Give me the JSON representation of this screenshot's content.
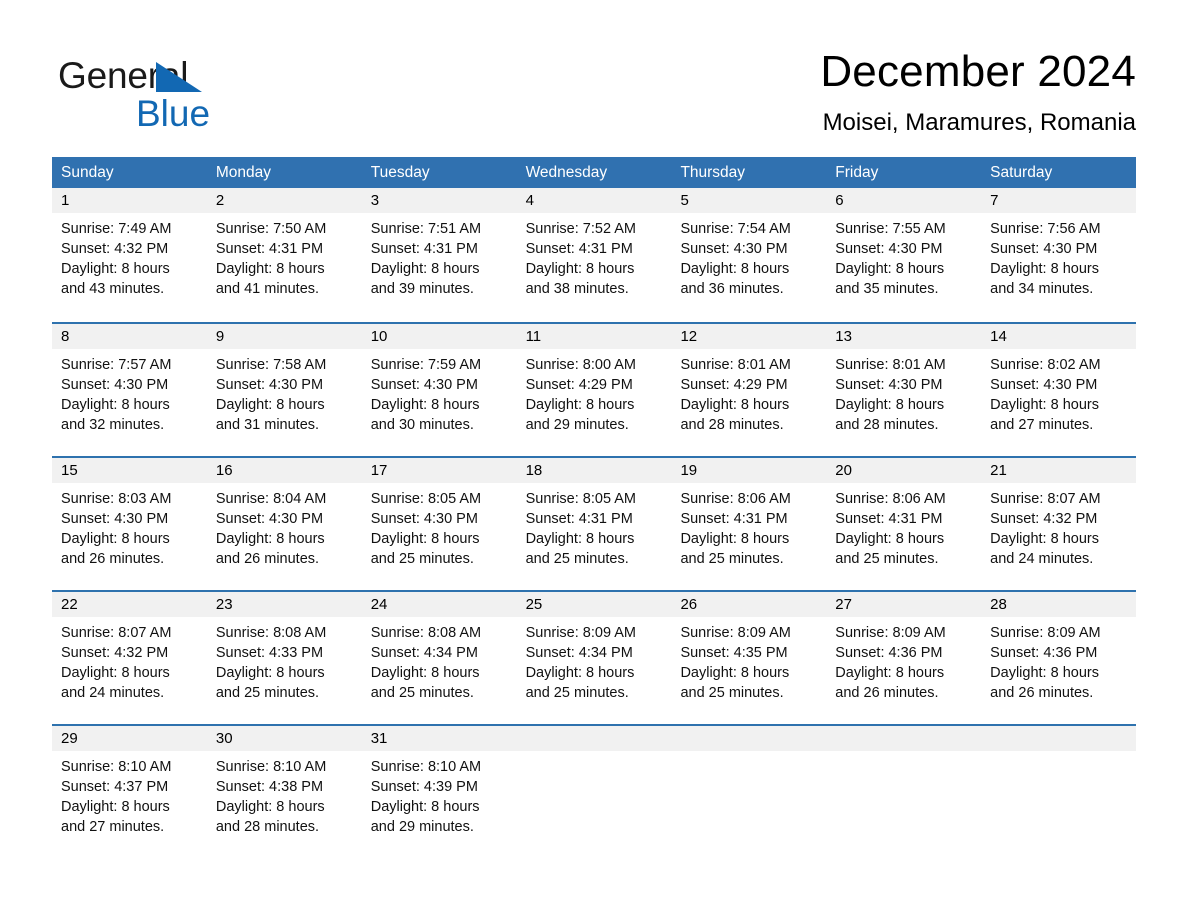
{
  "brand": {
    "name_part1": "General",
    "name_part2": "Blue",
    "triangle_color": "#1268b3",
    "text_color": "#1a1a1a"
  },
  "header": {
    "month_title": "December 2024",
    "location": "Moisei, Maramures, Romania"
  },
  "theme": {
    "header_blue": "#3071b0",
    "row_divider_blue": "#2e72ae",
    "day_band_gray": "#f1f1f1"
  },
  "weekdays": [
    "Sunday",
    "Monday",
    "Tuesday",
    "Wednesday",
    "Thursday",
    "Friday",
    "Saturday"
  ],
  "weeks": [
    [
      {
        "day": "1",
        "sunrise": "Sunrise: 7:49 AM",
        "sunset": "Sunset: 4:32 PM",
        "daylight_line1": "Daylight: 8 hours",
        "daylight_line2": "and 43 minutes."
      },
      {
        "day": "2",
        "sunrise": "Sunrise: 7:50 AM",
        "sunset": "Sunset: 4:31 PM",
        "daylight_line1": "Daylight: 8 hours",
        "daylight_line2": "and 41 minutes."
      },
      {
        "day": "3",
        "sunrise": "Sunrise: 7:51 AM",
        "sunset": "Sunset: 4:31 PM",
        "daylight_line1": "Daylight: 8 hours",
        "daylight_line2": "and 39 minutes."
      },
      {
        "day": "4",
        "sunrise": "Sunrise: 7:52 AM",
        "sunset": "Sunset: 4:31 PM",
        "daylight_line1": "Daylight: 8 hours",
        "daylight_line2": "and 38 minutes."
      },
      {
        "day": "5",
        "sunrise": "Sunrise: 7:54 AM",
        "sunset": "Sunset: 4:30 PM",
        "daylight_line1": "Daylight: 8 hours",
        "daylight_line2": "and 36 minutes."
      },
      {
        "day": "6",
        "sunrise": "Sunrise: 7:55 AM",
        "sunset": "Sunset: 4:30 PM",
        "daylight_line1": "Daylight: 8 hours",
        "daylight_line2": "and 35 minutes."
      },
      {
        "day": "7",
        "sunrise": "Sunrise: 7:56 AM",
        "sunset": "Sunset: 4:30 PM",
        "daylight_line1": "Daylight: 8 hours",
        "daylight_line2": "and 34 minutes."
      }
    ],
    [
      {
        "day": "8",
        "sunrise": "Sunrise: 7:57 AM",
        "sunset": "Sunset: 4:30 PM",
        "daylight_line1": "Daylight: 8 hours",
        "daylight_line2": "and 32 minutes."
      },
      {
        "day": "9",
        "sunrise": "Sunrise: 7:58 AM",
        "sunset": "Sunset: 4:30 PM",
        "daylight_line1": "Daylight: 8 hours",
        "daylight_line2": "and 31 minutes."
      },
      {
        "day": "10",
        "sunrise": "Sunrise: 7:59 AM",
        "sunset": "Sunset: 4:30 PM",
        "daylight_line1": "Daylight: 8 hours",
        "daylight_line2": "and 30 minutes."
      },
      {
        "day": "11",
        "sunrise": "Sunrise: 8:00 AM",
        "sunset": "Sunset: 4:29 PM",
        "daylight_line1": "Daylight: 8 hours",
        "daylight_line2": "and 29 minutes."
      },
      {
        "day": "12",
        "sunrise": "Sunrise: 8:01 AM",
        "sunset": "Sunset: 4:29 PM",
        "daylight_line1": "Daylight: 8 hours",
        "daylight_line2": "and 28 minutes."
      },
      {
        "day": "13",
        "sunrise": "Sunrise: 8:01 AM",
        "sunset": "Sunset: 4:30 PM",
        "daylight_line1": "Daylight: 8 hours",
        "daylight_line2": "and 28 minutes."
      },
      {
        "day": "14",
        "sunrise": "Sunrise: 8:02 AM",
        "sunset": "Sunset: 4:30 PM",
        "daylight_line1": "Daylight: 8 hours",
        "daylight_line2": "and 27 minutes."
      }
    ],
    [
      {
        "day": "15",
        "sunrise": "Sunrise: 8:03 AM",
        "sunset": "Sunset: 4:30 PM",
        "daylight_line1": "Daylight: 8 hours",
        "daylight_line2": "and 26 minutes."
      },
      {
        "day": "16",
        "sunrise": "Sunrise: 8:04 AM",
        "sunset": "Sunset: 4:30 PM",
        "daylight_line1": "Daylight: 8 hours",
        "daylight_line2": "and 26 minutes."
      },
      {
        "day": "17",
        "sunrise": "Sunrise: 8:05 AM",
        "sunset": "Sunset: 4:30 PM",
        "daylight_line1": "Daylight: 8 hours",
        "daylight_line2": "and 25 minutes."
      },
      {
        "day": "18",
        "sunrise": "Sunrise: 8:05 AM",
        "sunset": "Sunset: 4:31 PM",
        "daylight_line1": "Daylight: 8 hours",
        "daylight_line2": "and 25 minutes."
      },
      {
        "day": "19",
        "sunrise": "Sunrise: 8:06 AM",
        "sunset": "Sunset: 4:31 PM",
        "daylight_line1": "Daylight: 8 hours",
        "daylight_line2": "and 25 minutes."
      },
      {
        "day": "20",
        "sunrise": "Sunrise: 8:06 AM",
        "sunset": "Sunset: 4:31 PM",
        "daylight_line1": "Daylight: 8 hours",
        "daylight_line2": "and 25 minutes."
      },
      {
        "day": "21",
        "sunrise": "Sunrise: 8:07 AM",
        "sunset": "Sunset: 4:32 PM",
        "daylight_line1": "Daylight: 8 hours",
        "daylight_line2": "and 24 minutes."
      }
    ],
    [
      {
        "day": "22",
        "sunrise": "Sunrise: 8:07 AM",
        "sunset": "Sunset: 4:32 PM",
        "daylight_line1": "Daylight: 8 hours",
        "daylight_line2": "and 24 minutes."
      },
      {
        "day": "23",
        "sunrise": "Sunrise: 8:08 AM",
        "sunset": "Sunset: 4:33 PM",
        "daylight_line1": "Daylight: 8 hours",
        "daylight_line2": "and 25 minutes."
      },
      {
        "day": "24",
        "sunrise": "Sunrise: 8:08 AM",
        "sunset": "Sunset: 4:34 PM",
        "daylight_line1": "Daylight: 8 hours",
        "daylight_line2": "and 25 minutes."
      },
      {
        "day": "25",
        "sunrise": "Sunrise: 8:09 AM",
        "sunset": "Sunset: 4:34 PM",
        "daylight_line1": "Daylight: 8 hours",
        "daylight_line2": "and 25 minutes."
      },
      {
        "day": "26",
        "sunrise": "Sunrise: 8:09 AM",
        "sunset": "Sunset: 4:35 PM",
        "daylight_line1": "Daylight: 8 hours",
        "daylight_line2": "and 25 minutes."
      },
      {
        "day": "27",
        "sunrise": "Sunrise: 8:09 AM",
        "sunset": "Sunset: 4:36 PM",
        "daylight_line1": "Daylight: 8 hours",
        "daylight_line2": "and 26 minutes."
      },
      {
        "day": "28",
        "sunrise": "Sunrise: 8:09 AM",
        "sunset": "Sunset: 4:36 PM",
        "daylight_line1": "Daylight: 8 hours",
        "daylight_line2": "and 26 minutes."
      }
    ],
    [
      {
        "day": "29",
        "sunrise": "Sunrise: 8:10 AM",
        "sunset": "Sunset: 4:37 PM",
        "daylight_line1": "Daylight: 8 hours",
        "daylight_line2": "and 27 minutes."
      },
      {
        "day": "30",
        "sunrise": "Sunrise: 8:10 AM",
        "sunset": "Sunset: 4:38 PM",
        "daylight_line1": "Daylight: 8 hours",
        "daylight_line2": "and 28 minutes."
      },
      {
        "day": "31",
        "sunrise": "Sunrise: 8:10 AM",
        "sunset": "Sunset: 4:39 PM",
        "daylight_line1": "Daylight: 8 hours",
        "daylight_line2": "and 29 minutes."
      },
      {
        "day": "",
        "sunrise": "",
        "sunset": "",
        "daylight_line1": "",
        "daylight_line2": ""
      },
      {
        "day": "",
        "sunrise": "",
        "sunset": "",
        "daylight_line1": "",
        "daylight_line2": ""
      },
      {
        "day": "",
        "sunrise": "",
        "sunset": "",
        "daylight_line1": "",
        "daylight_line2": ""
      },
      {
        "day": "",
        "sunrise": "",
        "sunset": "",
        "daylight_line1": "",
        "daylight_line2": ""
      }
    ]
  ]
}
